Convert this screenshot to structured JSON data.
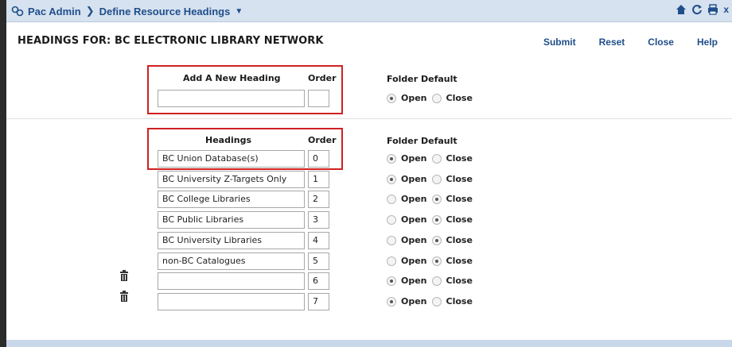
{
  "titlebar": {
    "app": "Pac Admin",
    "page": "Define Resource Headings",
    "icons": [
      "home-icon",
      "refresh-icon",
      "print-icon",
      "close-icon"
    ]
  },
  "header": {
    "title": "HEADINGS FOR: BC ELECTRONIC LIBRARY NETWORK"
  },
  "toolbar": {
    "submit": "Submit",
    "reset": "Reset",
    "close": "Close",
    "help": "Help"
  },
  "new_heading": {
    "label": "Add A New Heading",
    "order_label": "Order",
    "folder_label": "Folder Default",
    "value": "",
    "order": "",
    "open": "Open",
    "close": "Close",
    "default": "Open"
  },
  "headings": {
    "label": "Headings",
    "order_label": "Order",
    "folder_label": "Folder Default",
    "open_label": "Open",
    "close_label": "Close",
    "rows": [
      {
        "name": "BC Union Database(s)",
        "order": "0",
        "default": "Open",
        "trash": false
      },
      {
        "name": "BC University Z-Targets Only",
        "order": "1",
        "default": "Open",
        "trash": false
      },
      {
        "name": "BC College Libraries",
        "order": "2",
        "default": "Close",
        "trash": false
      },
      {
        "name": "BC Public Libraries",
        "order": "3",
        "default": "Close",
        "trash": false
      },
      {
        "name": "BC University Libraries",
        "order": "4",
        "default": "Close",
        "trash": false
      },
      {
        "name": "non-BC Catalogues",
        "order": "5",
        "default": "Close",
        "trash": false
      },
      {
        "name": "",
        "order": "6",
        "default": "Open",
        "trash": true
      },
      {
        "name": "",
        "order": "7",
        "default": "Open",
        "trash": true
      }
    ]
  },
  "colors": {
    "accent": "#1f4e8a",
    "titlebar_bg": "#d6e2f0",
    "highlight": "#d02020"
  }
}
